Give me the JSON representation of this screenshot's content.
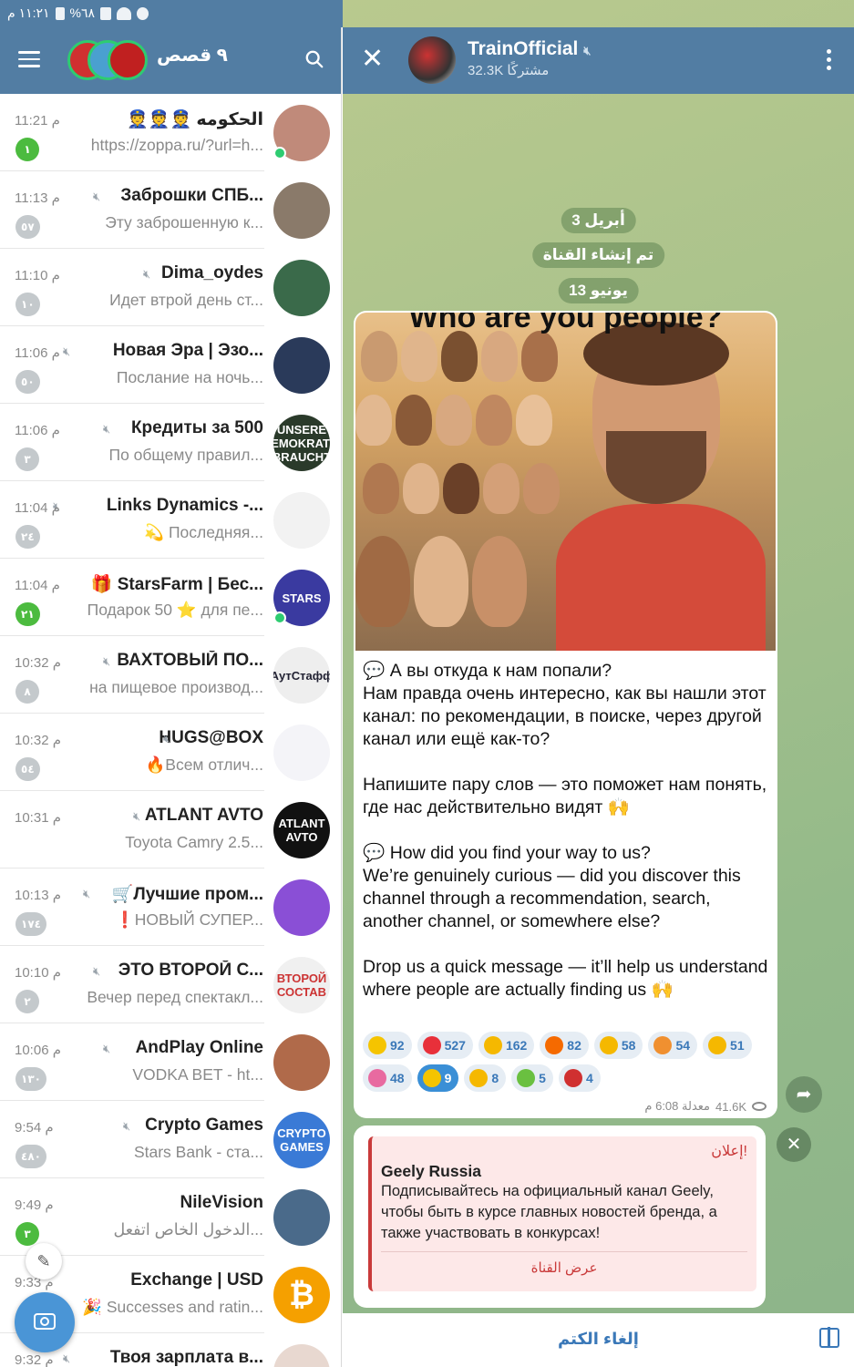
{
  "status_bar": {
    "time": "١١:٢١ م",
    "battery": "%٦٨"
  },
  "left_header": {
    "stories_title": "٩ قصص"
  },
  "chats": [
    {
      "name": "👮👮👮 الحكومه",
      "time": "11:21 م",
      "preview": "https://zoppa.ru/?url=h...",
      "badge": "١",
      "badge_green": true,
      "muted": false,
      "online": true,
      "avatar_color": "#c08a7a"
    },
    {
      "name": "Заброшки СПБ...",
      "time": "11:13 م",
      "preview": "Эту заброшенную к...",
      "badge": "٥٧",
      "badge_green": false,
      "muted": true,
      "avatar_color": "#8a7a6a"
    },
    {
      "name": "Dima_oydes",
      "time": "11:10 م",
      "preview": "Идет втрой день ст...",
      "badge": "١٠",
      "badge_green": false,
      "muted": true,
      "avatar_color": "#3a6a4a"
    },
    {
      "name": "Новая Эра | Эзо...",
      "time": "11:06 م",
      "preview": "Послание на ночь...",
      "badge": "٥٠",
      "badge_green": false,
      "muted": true,
      "avatar_color": "#2a3a5a"
    },
    {
      "name": "Кредиты за 500",
      "time": "11:06 م",
      "preview": "По общему правил...",
      "badge": "٣",
      "badge_green": false,
      "muted": true,
      "avatar_color": "#2a3a2a",
      "avatar_text": "UNSERE DEMOKRATIE BRAUCHT"
    },
    {
      "name": "Links Dynamics -...",
      "time": "11:04 م",
      "preview": "💫 Последняя...",
      "badge": "٢٤",
      "badge_green": false,
      "muted": true,
      "avatar_color": "#f2f2f2"
    },
    {
      "name": "🎁 StarsFarm | Бес...",
      "time": "11:04 م",
      "preview": "Подарок 50 ⭐ для пе...",
      "badge": "٢١",
      "badge_green": true,
      "muted": false,
      "online": true,
      "avatar_color": "#3a3aa0",
      "avatar_text": "STARS"
    },
    {
      "name": "ВАХТОВЫЙ ПО...",
      "time": "10:32 م",
      "preview": "на пищевое производ...",
      "badge": "٨",
      "badge_green": false,
      "muted": true,
      "avatar_color": "#eeeeee",
      "avatar_text": "АутСтафф",
      "avatar_text_color": "#223"
    },
    {
      "name": "HUGS@BOX",
      "time": "10:32 م",
      "preview": "🔥Всем отлич...",
      "badge": "٥٤",
      "badge_green": false,
      "muted": true,
      "avatar_color": "#f4f4f8"
    },
    {
      "name": "ATLANT AVTO",
      "time": "10:31 م",
      "preview": "Toyota Camry 2.5...",
      "badge": "",
      "badge_green": false,
      "muted": true,
      "avatar_color": "#111111",
      "avatar_text": "ATLANT AVTO"
    },
    {
      "name": "🛒Лучшие пром...",
      "time": "10:13 م",
      "preview": "❗НОВЫЙ СУПЕР...",
      "badge": "١٧٤",
      "badge_green": false,
      "muted": true,
      "avatar_color": "#8a4fd6"
    },
    {
      "name": "ЭТО ВТОРОЙ С...",
      "time": "10:10 م",
      "preview": "Вечер перед спектакл...",
      "badge": "٢",
      "badge_green": false,
      "muted": true,
      "avatar_color": "#f0f0f0",
      "avatar_text": "ВТОРОЙ СОСТАВ",
      "avatar_text_color": "#c33"
    },
    {
      "name": "AndPlay Online",
      "time": "10:06 م",
      "preview": "VODKA BET - ht...",
      "badge": "١٣٠",
      "badge_green": false,
      "muted": true,
      "avatar_color": "#b06a4a"
    },
    {
      "name": "Crypto Games",
      "time": "9:54 م",
      "preview": "Stars Bank - ста...",
      "badge": "٤٨٠",
      "badge_green": false,
      "muted": true,
      "avatar_color": "#3a7ad6",
      "avatar_text": "CRYPTO GAMES"
    },
    {
      "name": "NileVision",
      "time": "9:49 م",
      "preview": "الدخول الخاص اتفعل...",
      "badge": "٣",
      "badge_green": true,
      "muted": false,
      "avatar_color": "#4a6a8a"
    },
    {
      "name": "Exchange | USD",
      "time": "9:33 م",
      "preview": "🎉 Successes and ratin...",
      "badge": "",
      "badge_green": false,
      "muted": false,
      "avatar_color": "#f5a000",
      "avatar_text": "₿"
    },
    {
      "name": "Твоя зарплата в...",
      "time": "9:32 م",
      "preview": "",
      "badge": "",
      "badge_green": false,
      "muted": true,
      "avatar_color": "#e8d8d0"
    }
  ],
  "channel": {
    "title": "TrainOfficial",
    "subscribers": "32.3K مشتركًا"
  },
  "date_pills": [
    "3 أبريل",
    "تم إنشاء القناة",
    "13 يونيو"
  ],
  "post": {
    "image_caption": "Who are you people?",
    "text": "💬 А вы откуда к нам попали?\nНам правда очень интересно, как вы нашли этот канал: по рекомендации, в поиске, через другой канал или ещё как-то?\n\nНапишите пару слов — это поможет нам понять, где нас действительно видят 🙌\n\n💬 How did you find your way to us?\nWe’re genuinely curious — did you discover this channel through a recommendation, search, another channel, or somewhere else?\n\nDrop us a quick message — it’ll help us understand where people are actually finding us 🙌",
    "reactions": [
      {
        "emoji": "⭐",
        "count": "92",
        "color": "#f5c400"
      },
      {
        "emoji": "❤️",
        "count": "527",
        "color": "#e8303a"
      },
      {
        "emoji": "👍",
        "count": "162",
        "color": "#f5b800"
      },
      {
        "emoji": "🔥",
        "count": "82",
        "color": "#f56a00"
      },
      {
        "emoji": "👏",
        "count": "58",
        "color": "#f5b800"
      },
      {
        "emoji": "🥰",
        "count": "54",
        "color": "#f09030"
      },
      {
        "emoji": "🤩",
        "count": "51",
        "color": "#f5b800"
      },
      {
        "emoji": "🎉",
        "count": "48",
        "color": "#e86aa0"
      },
      {
        "emoji": "🏆",
        "count": "9",
        "color": "#f5c400",
        "active": true
      },
      {
        "emoji": "👎",
        "count": "8",
        "color": "#f5b800"
      },
      {
        "emoji": "🤮",
        "count": "5",
        "color": "#6ac040"
      },
      {
        "emoji": "🤬",
        "count": "4",
        "color": "#d03030"
      }
    ],
    "views": "41.6K",
    "time_label": "معدلة 6:08 م"
  },
  "ad": {
    "label": "إعلان!",
    "title": "Geely Russia",
    "body": "Подписывайтесь на официальный канал Geely, чтобы быть в курсе главных новостей бренда, а также участвовать в конкурсах!",
    "link": "عرض القناة"
  },
  "bottom": {
    "unmute_label": "إلغاء الكتم"
  },
  "icons": {
    "menu": "hamburger-icon",
    "search": "search-icon",
    "close": "close-icon",
    "more": "kebab-icon",
    "share": "share-icon",
    "gift": "gift-icon",
    "camera": "camera-icon",
    "pencil": "pencil-icon"
  },
  "colors": {
    "header": "#527da3",
    "accent": "#3a78b8",
    "badge_green": "#4cbb3f",
    "badge_grey": "#c4c9cc"
  }
}
